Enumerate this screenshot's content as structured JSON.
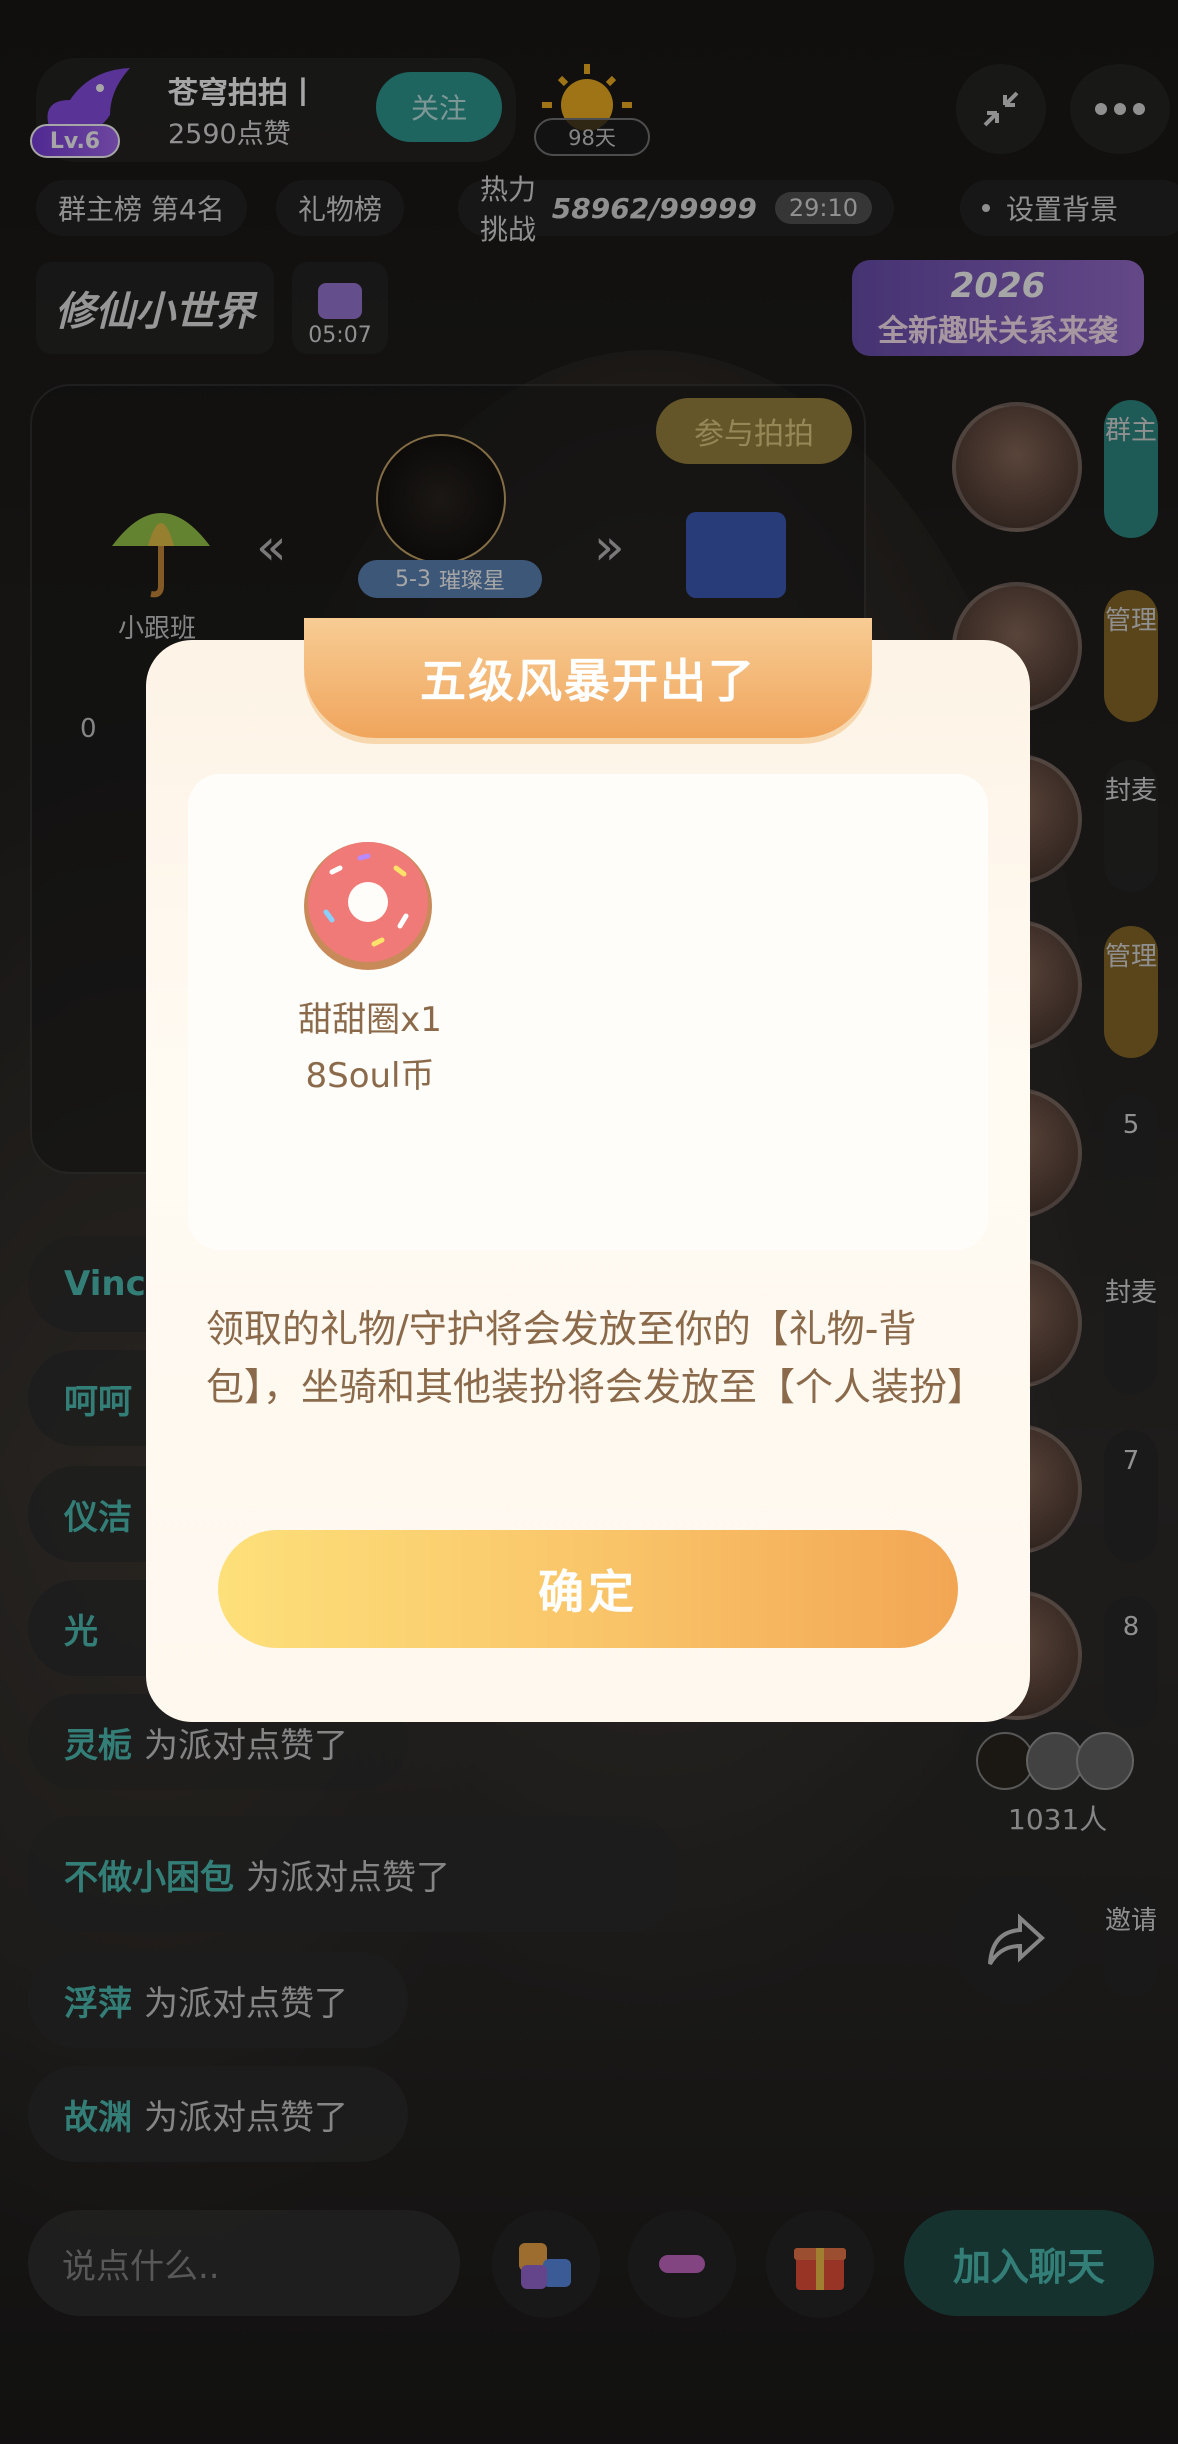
{
  "host": {
    "level": "Lv.6",
    "name": "苍穹拍拍丨",
    "likes": "2590点赞",
    "follow_label": "关注",
    "days": "98天"
  },
  "tabs": {
    "rank": "群主榜 第4名",
    "gift_rank": "礼物榜",
    "heat_label": "热力挑战",
    "heat_value": "58962/99999",
    "timer": "29:10",
    "bg_setting": "设置背景"
  },
  "banners": {
    "game_logo": "修仙小世界",
    "gift_timer": "05:07",
    "promo_year": "2026",
    "promo_text": "全新趣味关系来袭"
  },
  "stage": {
    "join_btn": "参与拍拍",
    "left_item": "小跟班",
    "rank_badge": "5-3",
    "star_name": "璀璨星",
    "score": "0"
  },
  "seats": [
    {
      "tag": "群主"
    },
    {
      "tag": "管理"
    },
    {
      "tag": "封麦"
    },
    {
      "tag": "管理"
    },
    {
      "tag": "5"
    },
    {
      "tag": "封麦"
    },
    {
      "tag": "7"
    },
    {
      "tag": "8"
    }
  ],
  "online_count": "1031人",
  "invite_label": "邀请",
  "chat": [
    {
      "name": "Vinc",
      "msg": ""
    },
    {
      "name": "呵呵",
      "msg": ""
    },
    {
      "name": "仪洁",
      "msg": ""
    },
    {
      "name": "光",
      "msg": ""
    },
    {
      "name": "灵栀",
      "msg": "为派对点赞了"
    },
    {
      "name": "不做小困包",
      "msg": "为派对点赞了"
    },
    {
      "name": "浮萍",
      "msg": "为派对点赞了"
    },
    {
      "name": "故渊",
      "msg": "为派对点赞了"
    }
  ],
  "bottom": {
    "input_placeholder": "说点什么..",
    "join_chat": "加入聊天"
  },
  "modal": {
    "title": "五级风暴开出了",
    "gift_name": "甜甜圈x1",
    "gift_price": "8Soul币",
    "note": "领取的礼物/守护将会发放至你的【礼物-背包】，坐骑和其他装扮将会发放至【个人装扮】",
    "confirm": "确定"
  },
  "colors": {
    "accent_teal": "#4fc3b9",
    "modal_orange": "#f0a55c",
    "confirm_yellow": "#fde07a"
  }
}
